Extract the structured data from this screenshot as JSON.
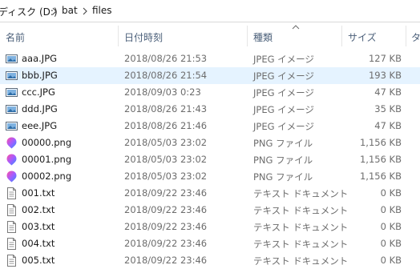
{
  "breadcrumb": {
    "drive": "ディスク (D:)",
    "folder1": "bat",
    "folder2": "files"
  },
  "columns": {
    "name": "名前",
    "date": "日付時刻",
    "type": "種類",
    "size": "サイズ",
    "tag": "タ"
  },
  "files": [
    {
      "name": "aaa.JPG",
      "date": "2018/08/26 21:53",
      "type": "JPEG イメージ",
      "size": "127 KB",
      "icon": "jpeg-image-icon"
    },
    {
      "name": "bbb.JPG",
      "date": "2018/08/26 21:54",
      "type": "JPEG イメージ",
      "size": "193 KB",
      "icon": "jpeg-image-icon",
      "selected": true
    },
    {
      "name": "ccc.JPG",
      "date": "2018/09/03 0:23",
      "type": "JPEG イメージ",
      "size": "47 KB",
      "icon": "jpeg-image-icon"
    },
    {
      "name": "ddd.JPG",
      "date": "2018/08/26 21:43",
      "type": "JPEG イメージ",
      "size": "35 KB",
      "icon": "jpeg-image-icon"
    },
    {
      "name": "eee.JPG",
      "date": "2018/08/26 21:46",
      "type": "JPEG イメージ",
      "size": "47 KB",
      "icon": "jpeg-image-icon"
    },
    {
      "name": "00000.png",
      "date": "2018/05/03 23:02",
      "type": "PNG ファイル",
      "size": "1,156 KB",
      "icon": "png-file-icon"
    },
    {
      "name": "00001.png",
      "date": "2018/05/03 23:02",
      "type": "PNG ファイル",
      "size": "1,156 KB",
      "icon": "png-file-icon"
    },
    {
      "name": "00002.png",
      "date": "2018/05/03 23:02",
      "type": "PNG ファイル",
      "size": "1,156 KB",
      "icon": "png-file-icon"
    },
    {
      "name": "001.txt",
      "date": "2018/09/22 23:46",
      "type": "テキスト ドキュメント",
      "size": "0 KB",
      "icon": "text-document-icon"
    },
    {
      "name": "002.txt",
      "date": "2018/09/22 23:46",
      "type": "テキスト ドキュメント",
      "size": "0 KB",
      "icon": "text-document-icon"
    },
    {
      "name": "003.txt",
      "date": "2018/09/22 23:46",
      "type": "テキスト ドキュメント",
      "size": "0 KB",
      "icon": "text-document-icon"
    },
    {
      "name": "004.txt",
      "date": "2018/09/22 23:46",
      "type": "テキスト ドキュメント",
      "size": "0 KB",
      "icon": "text-document-icon"
    },
    {
      "name": "005.txt",
      "date": "2018/09/22 23:46",
      "type": "テキスト ドキュメント",
      "size": "0 KB",
      "icon": "text-document-icon"
    }
  ],
  "colors": {
    "selection": "#e5f3ff",
    "header_text": "#4c607a",
    "meta_text": "#6d6d6d"
  }
}
